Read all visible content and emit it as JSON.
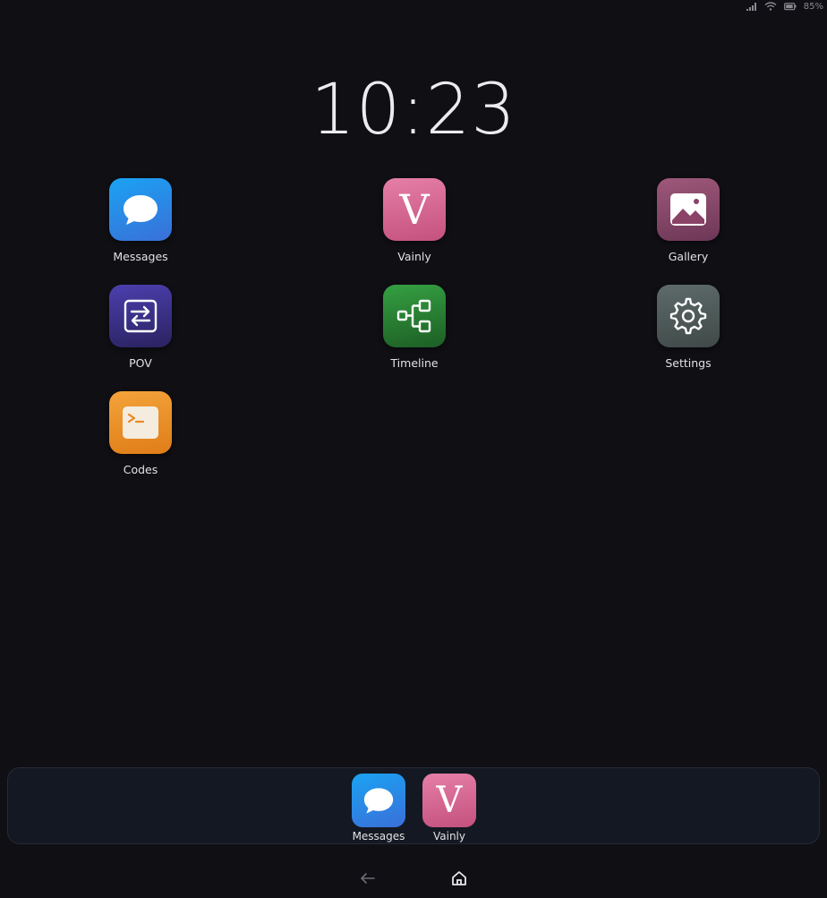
{
  "status": {
    "battery": "85%",
    "icons": [
      "signal-icon",
      "wifi-icon",
      "battery-icon"
    ]
  },
  "clock": {
    "time": "10:23"
  },
  "apps": [
    {
      "label": "Messages",
      "icon": "chat-bubble-icon",
      "color": "#1aa3f3"
    },
    {
      "label": "Vainly",
      "icon": "letter-v-icon",
      "glyph": "V",
      "color": "#e57fa7"
    },
    {
      "label": "Gallery",
      "icon": "image-icon",
      "color": "#9e587a"
    },
    {
      "label": "POV",
      "icon": "swap-arrows-icon",
      "color": "#4c3fae"
    },
    {
      "label": "Timeline",
      "icon": "flow-nodes-icon",
      "color": "#35a042"
    },
    {
      "label": "Settings",
      "icon": "gear-icon",
      "color": "#5e6b6a"
    },
    {
      "label": "Codes",
      "icon": "terminal-icon",
      "color": "#f3a33a"
    }
  ],
  "dock": {
    "items": [
      {
        "label": "Messages",
        "icon": "chat-bubble-icon"
      },
      {
        "label": "Vainly",
        "icon": "letter-v-icon",
        "glyph": "V"
      }
    ]
  },
  "nav": {
    "back_icon": "back-arrow-icon",
    "home_icon": "home-icon"
  }
}
